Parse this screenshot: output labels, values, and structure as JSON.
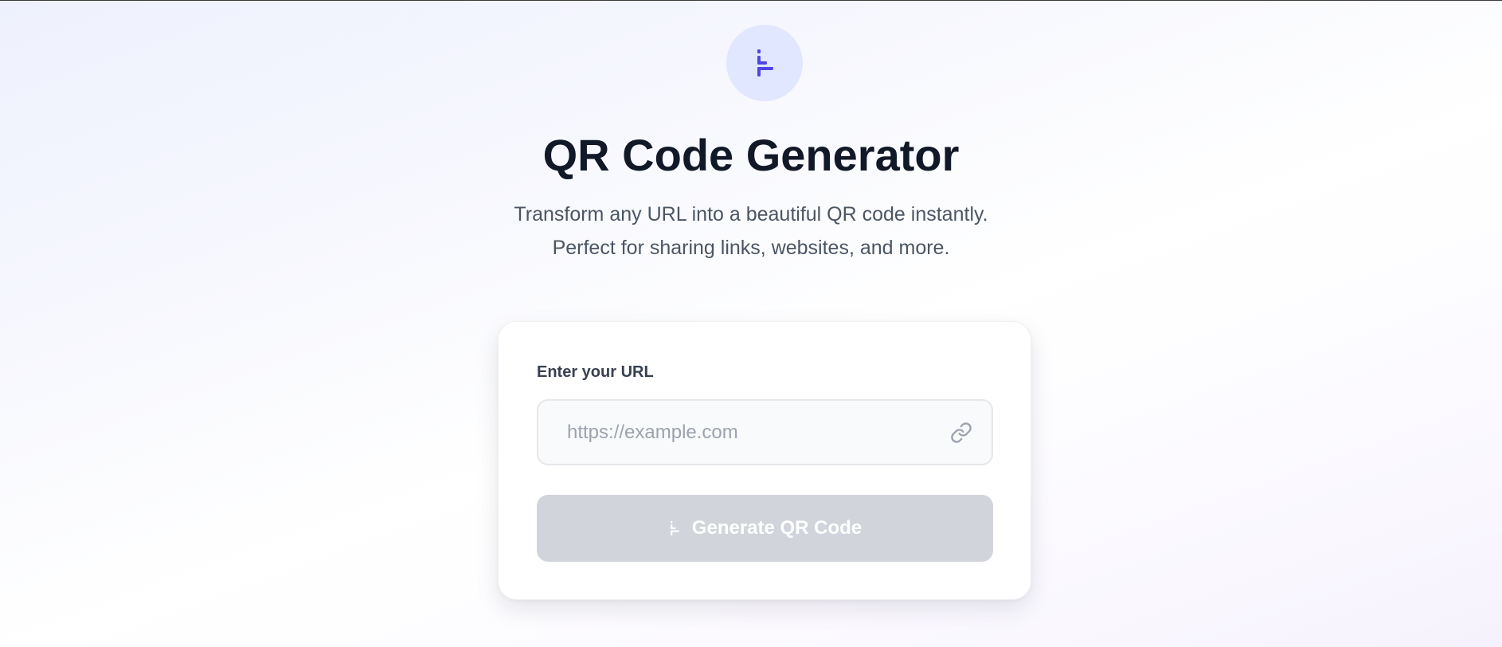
{
  "header": {
    "logo_icon": "qr-code-icon",
    "title": "QR Code Generator",
    "subtitle_lines": [
      "Transform any URL into a beautiful QR code instantly.",
      "Perfect for sharing links, websites, and more."
    ]
  },
  "form": {
    "label": "Enter your URL",
    "input": {
      "value": "",
      "placeholder": "https://example.com",
      "icon": "link-icon"
    },
    "button": {
      "label": "Generate QR Code",
      "icon": "qr-code-icon",
      "state": "disabled"
    }
  },
  "colors": {
    "accent": "#4f46e5",
    "logo_bg": "#e0e7ff",
    "title": "#111827",
    "button_disabled": "#d1d5db"
  }
}
